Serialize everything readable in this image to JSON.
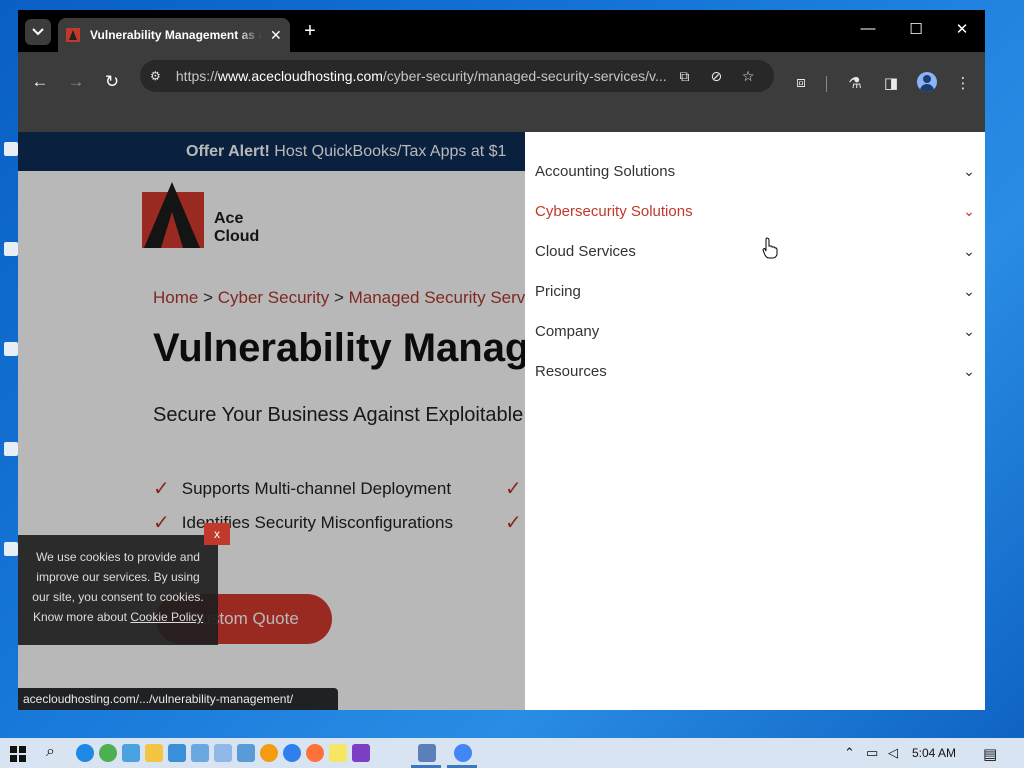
{
  "browser": {
    "tab_title": "Vulnerability Management as a Service",
    "tab_close": "✕",
    "new_tab": "+",
    "url_scheme": "https://",
    "url_host": "www.acecloudhosting.com",
    "url_path": "/cyber-security/managed-security-services/v...",
    "window_controls": [
      "—",
      "☐",
      "✕"
    ]
  },
  "page": {
    "offer_label": "Offer Alert!",
    "offer_text": " Host QuickBooks/Tax Apps at $1",
    "logo_text_1": "Ace",
    "logo_text_2": "Cloud",
    "breadcrumb": {
      "home": "Home",
      "sep": " > ",
      "cyber": "Cyber Security",
      "managed": "Managed Security Services"
    },
    "title": "Vulnerability Manage",
    "subtitle": "Secure Your Business Against Exploitable V",
    "features": [
      "Supports Multi-channel Deployment",
      "Identifies Security Misconfigurations"
    ],
    "cta_label": "Custom Quote",
    "cookie_text": "We use cookies to provide and improve our services. By using our site, you consent to cookies. Know more about ",
    "cookie_link": "Cookie Policy",
    "cookie_close": "x",
    "status_url": "acecloudhosting.com/.../vulnerability-management/"
  },
  "menu": {
    "items": [
      {
        "label": "Accounting Solutions",
        "active": false
      },
      {
        "label": "Cybersecurity Solutions",
        "active": true
      },
      {
        "label": "Cloud Services",
        "active": false
      },
      {
        "label": "Pricing",
        "active": false
      },
      {
        "label": "Company",
        "active": false
      },
      {
        "label": "Resources",
        "active": false
      }
    ],
    "active_color": "#c0392b"
  },
  "taskbar": {
    "time": "5:04 AM"
  },
  "colors": {
    "brand_red": "#d63b2e",
    "offer_bar": "#0d2d56",
    "browser_dark": "#3c3c3c"
  }
}
